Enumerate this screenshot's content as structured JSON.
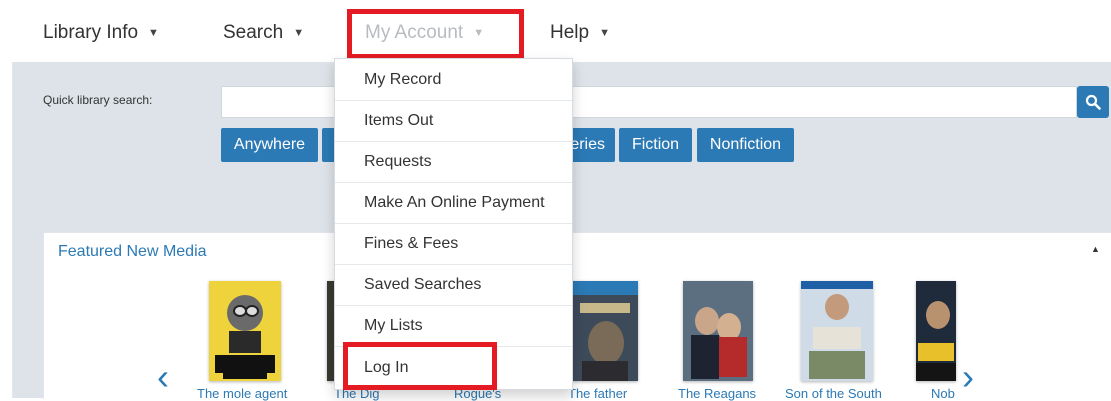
{
  "nav": {
    "library_info": "Library Info",
    "search": "Search",
    "my_account": "My Account",
    "help": "Help"
  },
  "quick_search": {
    "label": "Quick library search:",
    "placeholder": "",
    "buttons": [
      "Anywhere",
      "",
      "",
      "eries",
      "Fiction",
      "Nonfiction"
    ]
  },
  "dropdown": {
    "items": [
      "My Record",
      "Items Out",
      "Requests",
      "Make An Online Payment",
      "Fines & Fees",
      "Saved Searches",
      "My Lists",
      "Log In"
    ]
  },
  "featured": {
    "title": "Featured New Media",
    "items": [
      "The mole agent",
      "The Dig",
      "Rogue's",
      "The father",
      "The Reagans",
      "Son of the South",
      "Nob"
    ]
  },
  "colors": {
    "accent": "#2b79b5",
    "highlight": "#e41b23",
    "background": "#dde3e8"
  }
}
